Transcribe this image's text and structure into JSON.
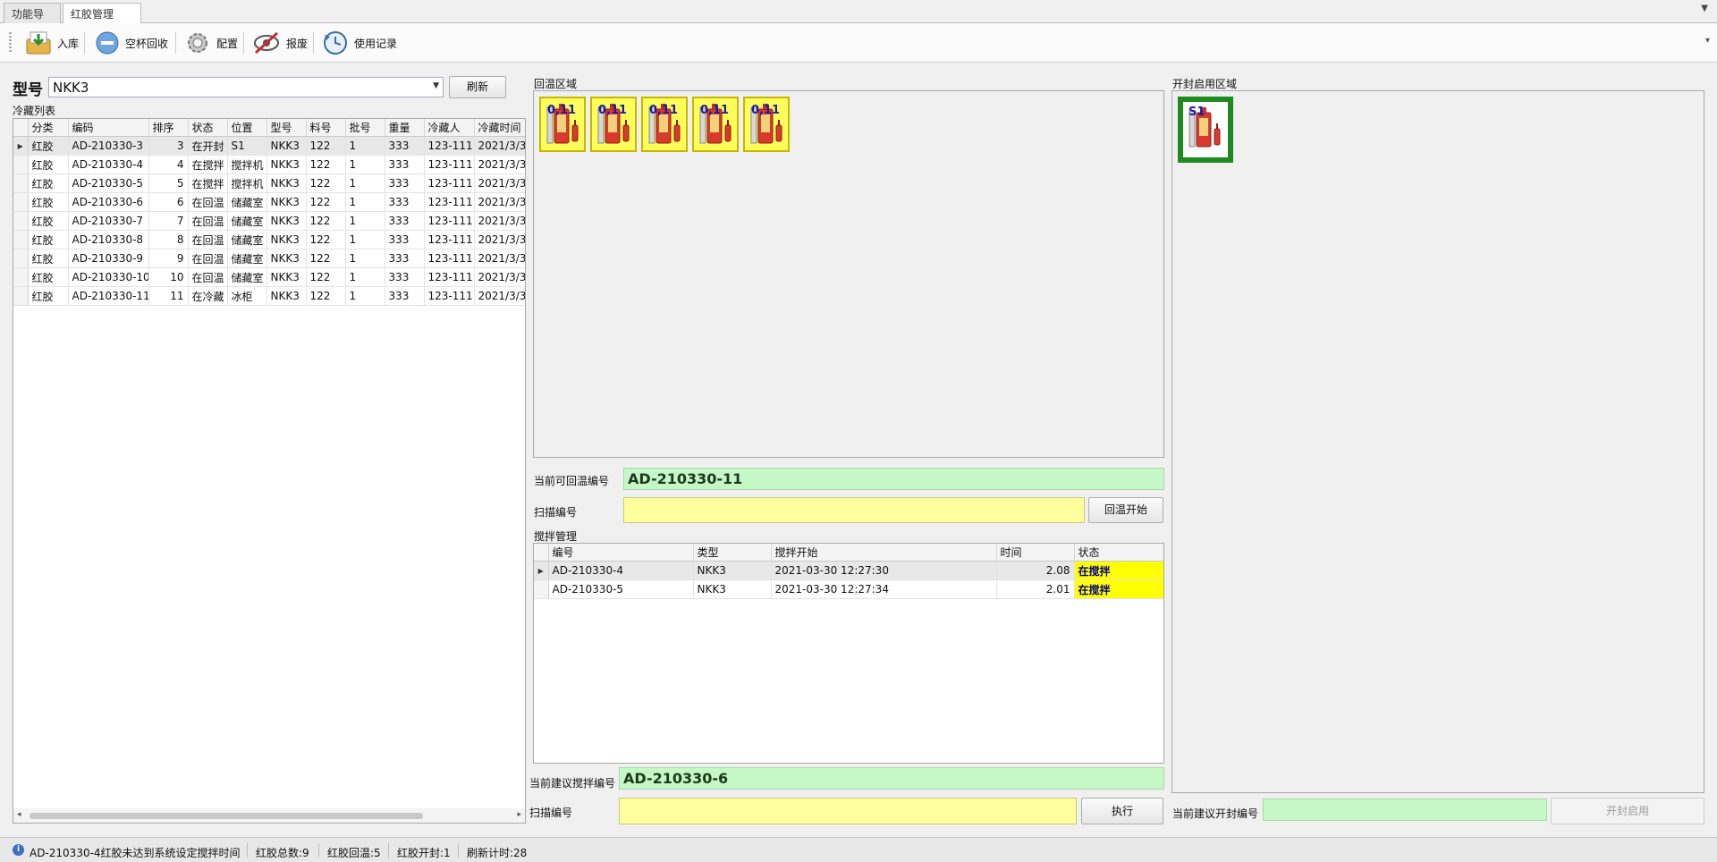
{
  "tabs": [
    {
      "label": "功能导航",
      "active": false
    },
    {
      "label": "红胶管理",
      "active": true,
      "close": "✕"
    }
  ],
  "toolbar": {
    "buttons": [
      {
        "label": "入库",
        "icon": "inbox-tray-icon"
      },
      {
        "label": "空杯回收",
        "icon": "minus-circle-icon"
      },
      {
        "label": "配置",
        "icon": "gear-icon"
      },
      {
        "label": "报废",
        "icon": "scrap-eye-icon"
      },
      {
        "label": "使用记录",
        "icon": "history-icon"
      }
    ]
  },
  "model": {
    "label": "型号",
    "value": "NKK3",
    "refresh": "刷新"
  },
  "cold_list": {
    "title": "冷藏列表",
    "columns": [
      "分类",
      "编码",
      "排序",
      "状态",
      "位置",
      "型号",
      "料号",
      "批号",
      "重量",
      "冷藏人",
      "冷藏时间"
    ],
    "rows": [
      [
        "红胶",
        "AD-210330-3",
        "3",
        "在开封",
        "S1",
        "NKK3",
        "122",
        "1",
        "333",
        "123-111",
        "2021/3/3"
      ],
      [
        "红胶",
        "AD-210330-4",
        "4",
        "在搅拌",
        "搅拌机",
        "NKK3",
        "122",
        "1",
        "333",
        "123-111",
        "2021/3/3"
      ],
      [
        "红胶",
        "AD-210330-5",
        "5",
        "在搅拌",
        "搅拌机",
        "NKK3",
        "122",
        "1",
        "333",
        "123-111",
        "2021/3/3"
      ],
      [
        "红胶",
        "AD-210330-6",
        "6",
        "在回温",
        "储藏室",
        "NKK3",
        "122",
        "1",
        "333",
        "123-111",
        "2021/3/3"
      ],
      [
        "红胶",
        "AD-210330-7",
        "7",
        "在回温",
        "储藏室",
        "NKK3",
        "122",
        "1",
        "333",
        "123-111",
        "2021/3/3"
      ],
      [
        "红胶",
        "AD-210330-8",
        "8",
        "在回温",
        "储藏室",
        "NKK3",
        "122",
        "1",
        "333",
        "123-111",
        "2021/3/3"
      ],
      [
        "红胶",
        "AD-210330-9",
        "9",
        "在回温",
        "储藏室",
        "NKK3",
        "122",
        "1",
        "333",
        "123-111",
        "2021/3/3"
      ],
      [
        "红胶",
        "AD-210330-10",
        "10",
        "在回温",
        "储藏室",
        "NKK3",
        "122",
        "1",
        "333",
        "123-111",
        "2021/3/3"
      ],
      [
        "红胶",
        "AD-210330-11",
        "11",
        "在冷藏",
        "冰柜",
        "NKK3",
        "122",
        "1",
        "333",
        "123-111",
        "2021/3/3"
      ]
    ]
  },
  "rewarm_area": {
    "title": "回温区域",
    "items": [
      "0,11",
      "0,11",
      "0,11",
      "0,11",
      "0,11"
    ]
  },
  "open_area": {
    "title": "开封启用区域",
    "items": [
      "S1"
    ]
  },
  "rewarm": {
    "current_label": "当前可回温编号",
    "current_value": "AD-210330-11",
    "scan_label": "扫描编号",
    "scan_value": "",
    "start_button": "回温开始"
  },
  "mixing": {
    "title": "搅拌管理",
    "columns": [
      "编号",
      "类型",
      "搅拌开始",
      "时间",
      "状态"
    ],
    "rows": [
      [
        "AD-210330-4",
        "NKK3",
        "2021-03-30 12:27:30",
        "2.08",
        "在搅拌"
      ],
      [
        "AD-210330-5",
        "NKK3",
        "2021-03-30 12:27:34",
        "2.01",
        "在搅拌"
      ]
    ],
    "suggest_label": "当前建议搅拌编号",
    "suggest_value": "AD-210330-6",
    "scan_label": "扫描编号",
    "scan_value": "",
    "exec_button": "执行"
  },
  "open": {
    "suggest_label": "当前建议开封编号",
    "suggest_value": "",
    "open_button": "开封启用"
  },
  "status": {
    "message": "AD-210330-4红胶未达到系统设定搅拌时间",
    "total": "红胶总数:9",
    "rewarm": "红胶回温:5",
    "opened": "红胶开封:1",
    "refresh": "刷新计时:28"
  },
  "colors": {
    "stat_yellow": "#ffff00",
    "green_field": "#c6f7c6",
    "yellow_field": "#ffff9e",
    "green_frame": "#1f8a1f"
  }
}
